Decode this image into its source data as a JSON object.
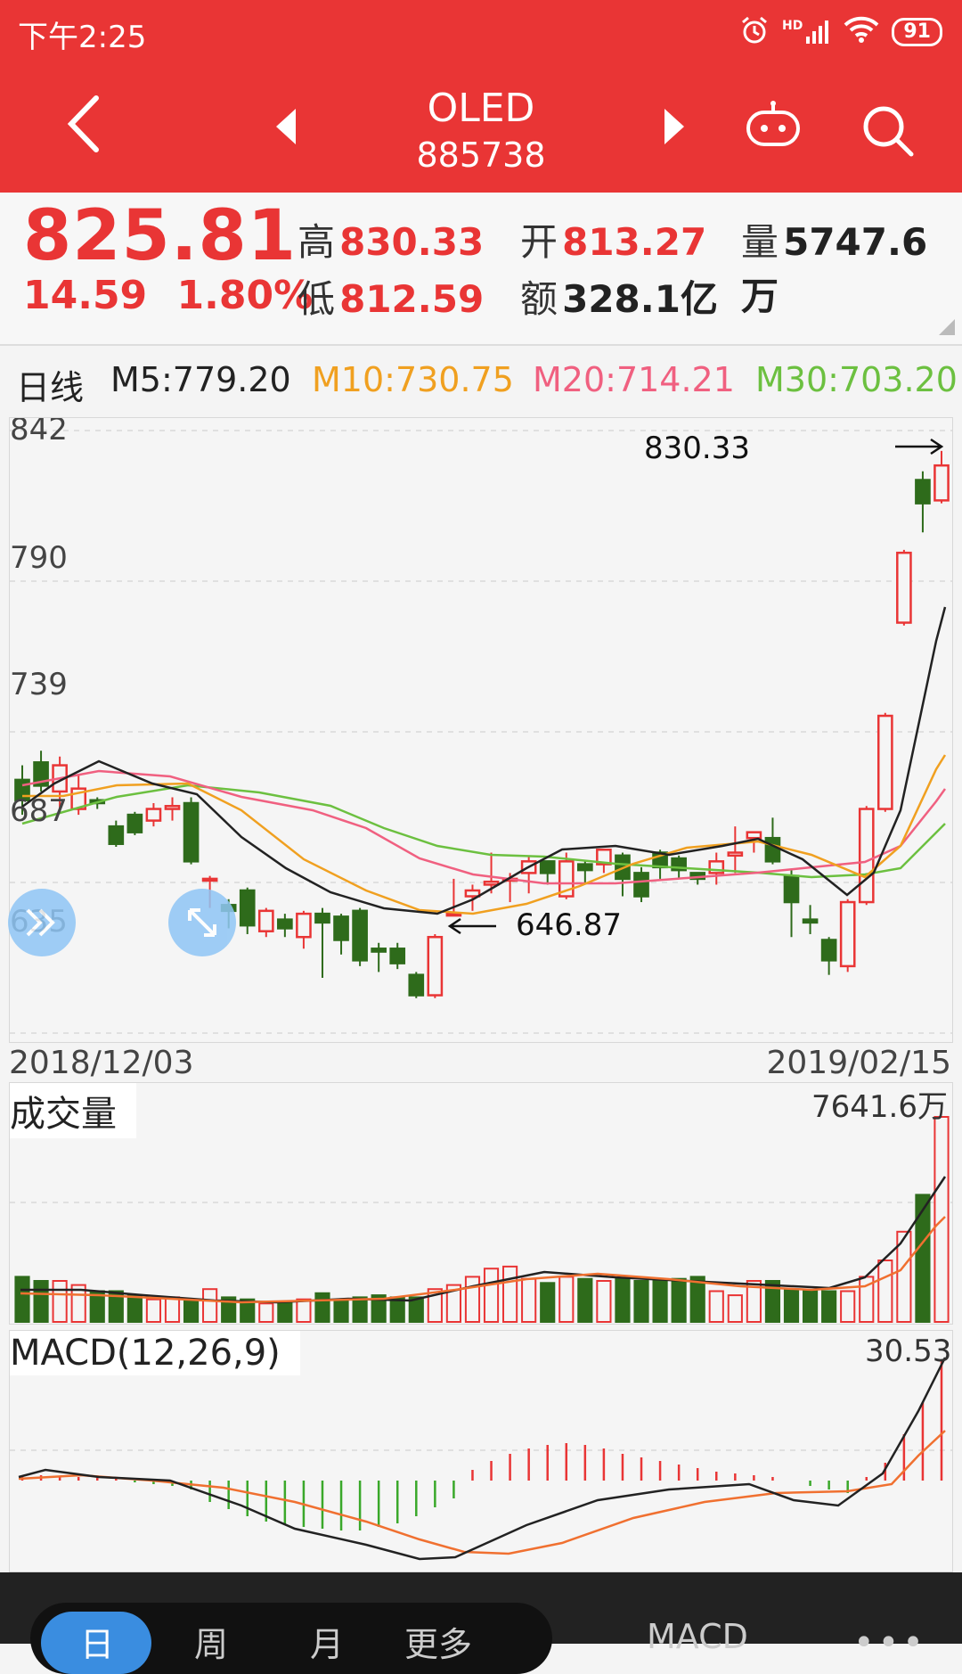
{
  "status": {
    "time": "下午2:25",
    "battery": "91",
    "network": "HD"
  },
  "header": {
    "title": "OLED",
    "code": "885738"
  },
  "quote": {
    "price": "825.81",
    "change": "14.59",
    "change_pct": "1.80%",
    "high_label": "高",
    "high": "830.33",
    "low_label": "低",
    "low": "812.59",
    "open_label": "开",
    "open": "813.27",
    "amount_label": "额",
    "amount": "328.1亿",
    "volume_label": "量",
    "volume": "5747.6万"
  },
  "ma_row": {
    "period": "日线",
    "ma5": "M5:779.20",
    "ma10": "M10:730.75",
    "ma20": "M20:714.21",
    "ma30": "M30:703.20"
  },
  "price_chart": {
    "y_ticks": [
      "842",
      "790",
      "739",
      "687",
      "635"
    ],
    "max_label": "830.33",
    "min_label": "646.87",
    "start_date": "2018/12/03",
    "end_date": "2019/02/15"
  },
  "volume_chart": {
    "label": "成交量",
    "max": "7641.6万"
  },
  "macd_chart": {
    "label": "MACD(12,26,9)",
    "max": "30.53"
  },
  "bottom_tabs": [
    {
      "label": "日"
    },
    {
      "label": "周"
    },
    {
      "label": "月"
    },
    {
      "label": "更多"
    },
    {
      "label": "MACD"
    }
  ],
  "colors": {
    "header": "#e93535",
    "up": "#e93535",
    "down": "#2e6b1b",
    "ma5": "#222222",
    "ma10": "#f0a020",
    "ma20": "#f06080",
    "ma30": "#6cc040",
    "macd_dif": "#222222",
    "macd_dea": "#f07030"
  },
  "chart_data": {
    "type": "candlestick",
    "x": [
      "2018/12/03",
      "2019/02/15"
    ],
    "ylim": [
      635,
      842
    ],
    "y_ticks": [
      842,
      790,
      739,
      687,
      635
    ],
    "candles": [
      [
        722,
        715,
        727,
        710
      ],
      [
        728,
        720,
        732,
        718
      ],
      [
        718,
        727,
        730,
        712
      ],
      [
        712,
        719,
        724,
        710
      ],
      [
        715,
        714,
        716,
        712
      ],
      [
        706,
        700,
        708,
        699
      ],
      [
        710,
        704,
        711,
        703
      ],
      [
        708,
        712,
        714,
        706
      ],
      [
        712,
        713,
        716,
        708
      ],
      [
        714,
        694,
        716,
        693
      ],
      [
        688,
        688,
        689,
        678
      ],
      [
        679,
        677,
        681,
        671
      ],
      [
        684,
        672,
        685,
        669
      ],
      [
        670,
        677,
        678,
        668
      ],
      [
        674,
        671,
        676,
        668
      ],
      [
        668,
        676,
        677,
        664
      ],
      [
        676,
        673,
        678,
        654
      ],
      [
        675,
        667,
        676,
        662
      ],
      [
        677,
        660,
        678,
        658
      ],
      [
        664,
        663,
        666,
        656
      ],
      [
        664,
        659,
        666,
        657
      ],
      [
        655,
        648,
        656,
        647
      ],
      [
        648,
        668,
        669,
        647
      ],
      [
        676,
        676,
        688,
        676
      ],
      [
        682,
        684,
        686,
        677
      ],
      [
        686,
        687,
        697,
        683
      ],
      [
        688,
        688,
        690,
        680
      ],
      [
        690,
        694,
        696,
        683
      ],
      [
        694,
        690,
        693,
        686
      ],
      [
        682,
        694,
        697,
        681
      ],
      [
        693,
        691,
        694,
        686
      ],
      [
        693,
        698,
        698,
        690
      ],
      [
        696,
        688,
        697,
        682
      ],
      [
        690,
        682,
        692,
        680
      ],
      [
        697,
        692,
        698,
        688
      ],
      [
        695,
        691,
        696,
        688
      ],
      [
        690,
        688,
        690,
        686
      ],
      [
        690,
        694,
        697,
        686
      ],
      [
        696,
        697,
        706,
        690
      ],
      [
        702,
        704,
        704,
        697
      ],
      [
        702,
        694,
        709,
        693
      ],
      [
        689,
        680,
        691,
        668
      ],
      [
        674,
        673,
        679,
        669
      ],
      [
        667,
        660,
        668,
        655
      ],
      [
        658,
        680,
        681,
        656
      ],
      [
        680,
        712,
        713,
        679
      ],
      [
        712,
        744,
        745,
        711
      ],
      [
        776,
        800,
        801,
        775
      ],
      [
        825,
        817,
        828,
        807
      ],
      [
        818,
        830,
        835,
        817
      ]
    ],
    "ma_values": {
      "M5": "779.20",
      "M10": "730.75",
      "M20": "714.21",
      "M30": "703.20"
    },
    "volume": {
      "max": 7641.6,
      "unit": "万"
    },
    "macd": {
      "max": 30.53
    }
  }
}
